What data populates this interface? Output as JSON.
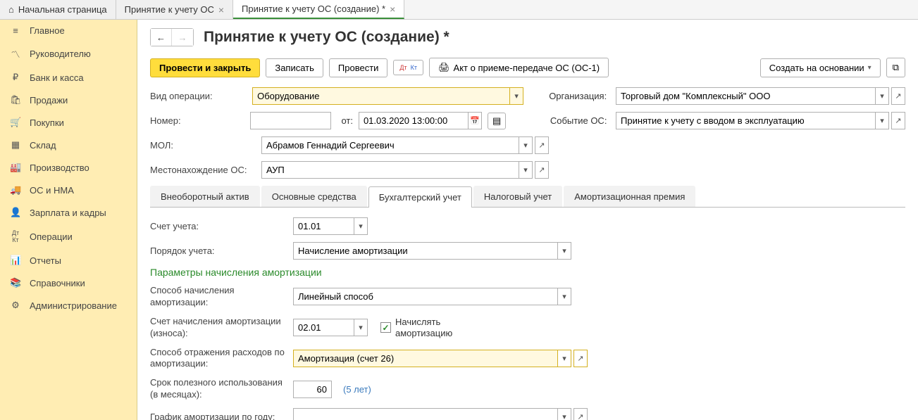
{
  "tabs": [
    {
      "label": "Начальная страница",
      "closable": false,
      "icon": "home"
    },
    {
      "label": "Принятие к учету ОС",
      "closable": true
    },
    {
      "label": "Принятие к учету ОС (создание) *",
      "closable": true,
      "active": true
    }
  ],
  "sidebar": {
    "items": [
      {
        "label": "Главное",
        "icon": "≡"
      },
      {
        "label": "Руководителю",
        "icon": "↗"
      },
      {
        "label": "Банк и касса",
        "icon": "₽"
      },
      {
        "label": "Продажи",
        "icon": "🛍"
      },
      {
        "label": "Покупки",
        "icon": "🛒"
      },
      {
        "label": "Склад",
        "icon": "▦"
      },
      {
        "label": "Производство",
        "icon": "🏭"
      },
      {
        "label": "ОС и НМА",
        "icon": "🚚"
      },
      {
        "label": "Зарплата и кадры",
        "icon": "👤"
      },
      {
        "label": "Операции",
        "icon": "Дт/Кт"
      },
      {
        "label": "Отчеты",
        "icon": "📊"
      },
      {
        "label": "Справочники",
        "icon": "📚"
      },
      {
        "label": "Администрирование",
        "icon": "⚙"
      }
    ]
  },
  "page": {
    "title": "Принятие к учету ОС (создание) *"
  },
  "toolbar": {
    "post_close": "Провести и закрыть",
    "save": "Записать",
    "post": "Провести",
    "dtkt": "Дт/Кт",
    "act": "Акт о приеме-передаче ОС (ОС-1)",
    "create_based": "Создать на основании"
  },
  "fields": {
    "operation_type_label": "Вид операции:",
    "operation_type_value": "Оборудование",
    "org_label": "Организация:",
    "org_value": "Торговый дом \"Комплексный\" ООО",
    "number_label": "Номер:",
    "number_value": "",
    "from_label": "от:",
    "date_value": "01.03.2020 13:00:00",
    "event_label": "Событие ОС:",
    "event_value": "Принятие к учету с вводом в эксплуатацию",
    "mol_label": "МОЛ:",
    "mol_value": "Абрамов Геннадий Сергеевич",
    "location_label": "Местонахождение ОС:",
    "location_value": "АУП"
  },
  "subtabs": [
    "Внеоборотный актив",
    "Основные средства",
    "Бухгалтерский учет",
    "Налоговый учет",
    "Амортизационная премия"
  ],
  "subtab_active": 2,
  "accounting": {
    "account_label": "Счет учета:",
    "account_value": "01.01",
    "order_label": "Порядок учета:",
    "order_value": "Начисление амортизации",
    "section_title": "Параметры начисления амортизации",
    "method_label": "Способ начисления амортизации:",
    "method_value": "Линейный способ",
    "amort_account_label": "Счет начисления амортизации (износа):",
    "amort_account_value": "02.01",
    "charge_checkbox_label": "Начислять амортизацию",
    "charge_checked": true,
    "expense_label": "Способ отражения расходов по амортизации:",
    "expense_value": "Амортизация (счет 26)",
    "life_label": "Срок полезного использования (в месяцах):",
    "life_value": "60",
    "life_hint": "(5 лет)",
    "schedule_label": "График амортизации по году:",
    "schedule_value": ""
  }
}
